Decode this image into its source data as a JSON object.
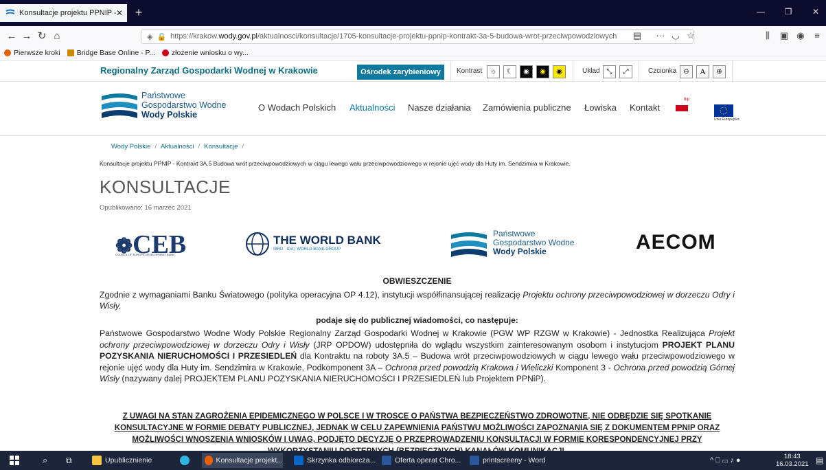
{
  "browser": {
    "tab_title": "Konsultacje projektu PPNIP - K",
    "tab_close": "✕",
    "new_tab": "+",
    "url_prefix": "https://krakow.",
    "url_domain": "wody.gov.pl",
    "url_suffix": "/aktualnosci/konsultacje/1705-konsultacje-projektu-ppnip-kontrakt-3a-5-budowa-wrot-przeciwpowodziowych",
    "bookmarks": [
      "Pierwsze kroki",
      "Bridge Base Online - P...",
      "złożenie wniosku o wy..."
    ]
  },
  "topstrip": {
    "org_name": "Regionalny Zarząd Gospodarki Wodnej w Krakowie",
    "osrodek_button": "Ośrodek zarybieniowy",
    "contrast_label": "Kontrast",
    "layout_label": "Układ",
    "font_label": "Czcionka",
    "font_a": "A"
  },
  "header": {
    "logo_line1": "Państwowe",
    "logo_line2": "Gospodarstwo Wodne",
    "logo_line3": "Wody Polskie",
    "menu": [
      "O Wodach Polskich",
      "Aktualności",
      "Nasze działania",
      "Zamówienia publiczne",
      "Łowiska",
      "Kontakt"
    ],
    "bip_label": "bip",
    "eu_label": "Unia Europejska"
  },
  "breadcrumb": [
    "Wody Polskie",
    "Aktualności",
    "Konsultacje"
  ],
  "breadcrumb_sep": "/",
  "subtitle": "Konsultacje projektu PPNIP - Kontrakt 3A.5 Budowa wrót przeciwpowodziowych w ciągu lewego wału przeciwpowodziowego w rejonie ujęć wody dla Huty im. Sendzimira w Krakowie.",
  "page_title": "KONSULTACJE",
  "published": "Opublikowano: 16 marzec 2021",
  "logos": {
    "ceb": "CEB",
    "ceb_sub": "COUNCIL OF EUROPE DEVELOPMENT BANK",
    "wb_main": "THE WORLD BANK",
    "wb_sub": "IBRD · IDA | WORLD BANK GROUP",
    "pgw_line1": "Państwowe",
    "pgw_line2": "Gospodarstwo Wodne",
    "pgw_line3": "Wody Polskie",
    "aecom": "AECOM"
  },
  "article": {
    "heading": "OBWIESZCZENIE",
    "p1_a": "Zgodnie z wymaganiami Banku Światowego (polityka operacyjna OP 4.12), instytucji współfinansującej realizację ",
    "p1_em": "Projektu ochrony przeciwpowodziowej w dorzeczu Odry i Wisły,",
    "subheading": "podaje się do publicznej wiadomości, co następuje:",
    "p2_a": "Państwowe Gospodarstwo Wodne Wody Polskie Regionalny Zarząd Gospodarki Wodnej w Krakowie (PGW WP RZGW w Krakowie) - Jednostka Realizująca ",
    "p2_em1": "Projekt ochrony przeciwpowodziowej w dorzeczu Odry i Wisły",
    "p2_b": " (JRP OPDOW) udostępniła do wglądu wszystkim zainteresowanym osobom i instytucjom ",
    "p2_strong": "PROJEKT PLANU POZYSKANIA NIERUCHOMOŚCI I PRZESIEDLEŃ",
    "p2_c": " dla Kontraktu na roboty 3A.5 – Budowa wrót przeciwpowodziowych w ciągu lewego wału przeciwpowodziowego w rejonie ujęć wody dla Huty im. Sendzimira w Krakowie, Podkomponent 3A – ",
    "p2_em2": "Ochrona przed powodzią Krakowa i Wieliczki",
    "p2_d": " Komponent 3 - ",
    "p2_em3": "Ochrona przed powodzią Górnej Wisły",
    "p2_e": " (nazywany dalej PROJEKTEM PLANU POZYSKANIA NIERUCHOMOŚCI I PRZESIEDLEŃ lub Projektem PPNiP).",
    "notice": "Z UWAGI NA STAN ZAGROŻENIA EPIDEMICZNEGO W POLSCE I W TROSCE O PAŃSTWA BEZPIECZEŃSTWO ZDROWOTNE, NIE ODBĘDZIE SIĘ SPOTKANIE KONSULTACYJNE W FORMIE DEBATY PUBLICZNEJ, JEDNAK W CELU ZAPEWNIENIA PAŃSTWU MOŻLIWOŚCI ZAPOZNANIA SIĘ Z DOKUMENTEM PPNIP ORAZ MOŻLIWOŚCI WNOSZENIA WNIOSKÓW I UWAG, PODJĘTO DECYZJĘ O PRZEPROWADZENIU KONSULTACJI W FORMIE KORESPONDENCYJNEJ PRZY WYKORZYSTANIU DOSTĘPNYCH (BEZPIECZNYCH) KANAŁÓW KOMUNIKACJI."
  },
  "taskbar": {
    "items": [
      "Upublicznienie",
      "Konsultacje projekt...",
      "Skrzynka odbiorcza...",
      "Oferta operat Chro...",
      "printscreeny - Word"
    ],
    "time": "18:43",
    "date": "16.03.2021"
  },
  "colors": {
    "brand": "#0d6e83",
    "button": "#0f7aa0",
    "tabbar": "#0c0c2e",
    "taskbar": "#1c2539"
  }
}
